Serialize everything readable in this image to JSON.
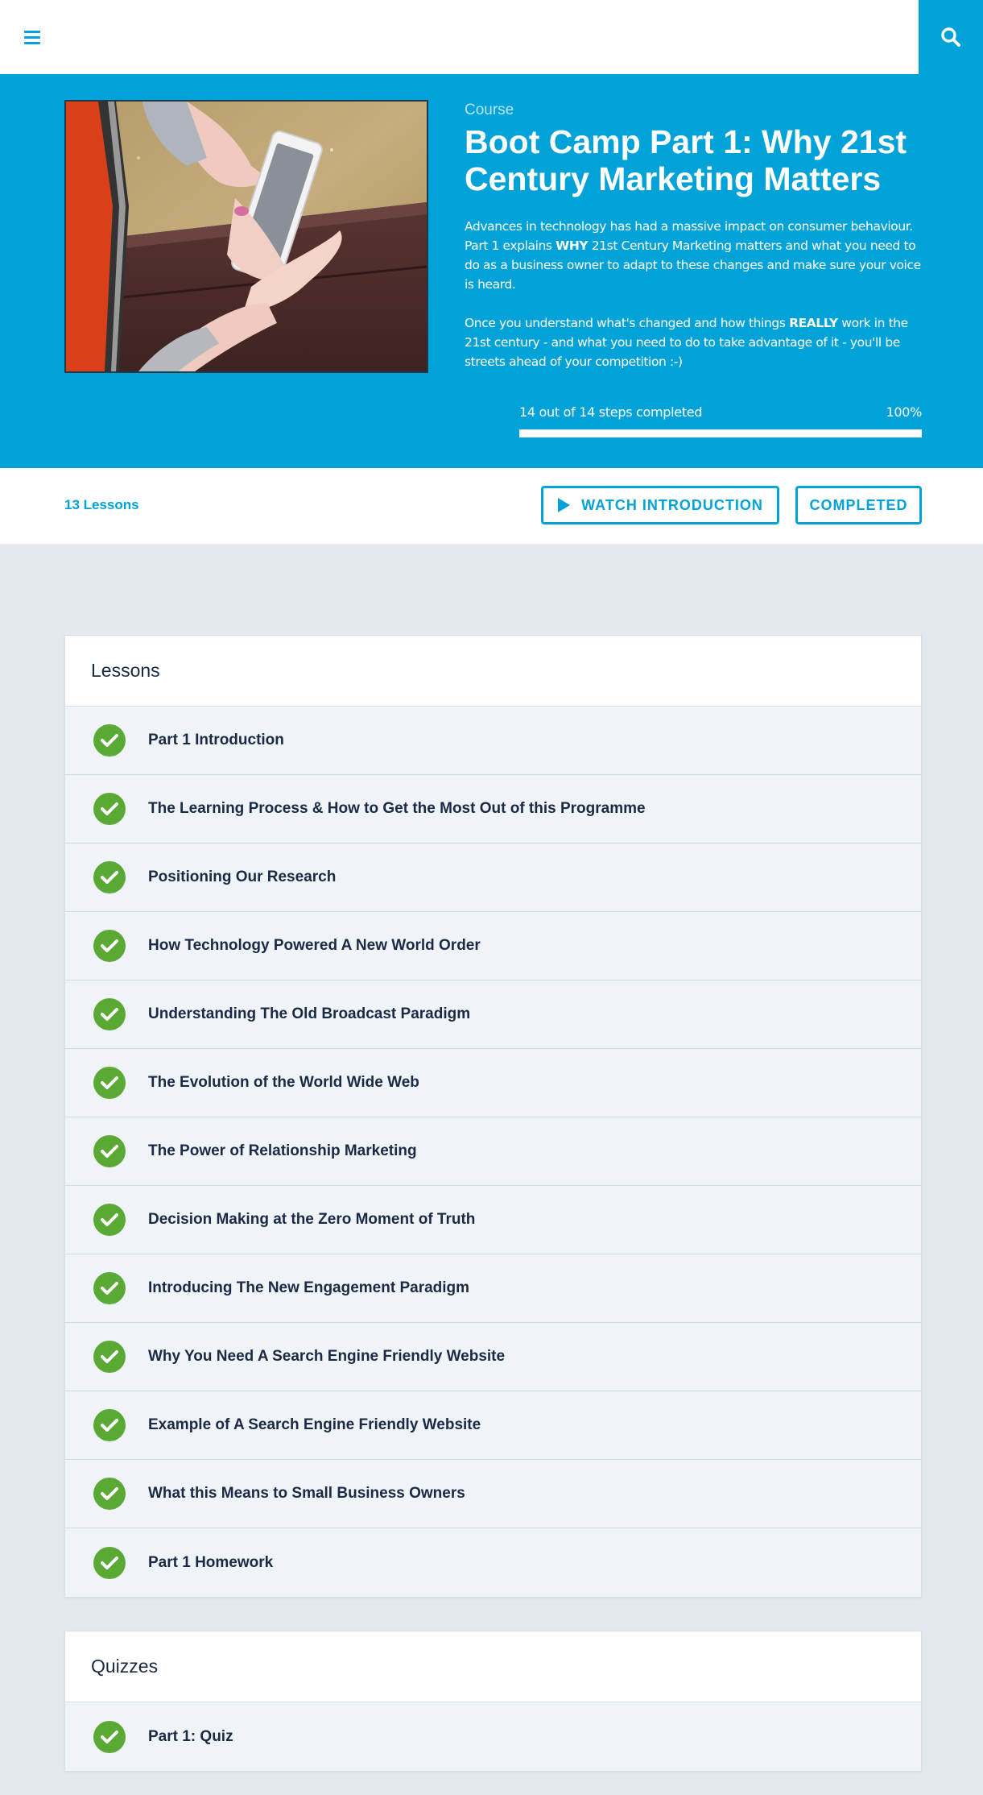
{
  "header": {
    "menu_icon": "hamburger-menu-icon",
    "search_icon": "search-icon"
  },
  "course": {
    "eyebrow": "Course",
    "title": "Boot Camp Part 1: Why 21st Century Marketing Matters",
    "desc1": {
      "a": "Advances in technology has had a massive impact on consumer behaviour. Part 1 explains ",
      "b": "WHY",
      "c": " 21st Century Marketing matters and what you need to do as a business owner to adapt to these changes and make sure your voice is heard."
    },
    "desc2": {
      "a": "Once you understand what's changed and how things ",
      "b": "REALLY",
      "c": " work in the 21st century - and what you need to do to take advantage of it - you'll be streets ahead of your competition :-)"
    },
    "progress_text": "14 out of 14 steps completed",
    "progress_percent_label": "100%",
    "progress_fraction": 1.0
  },
  "actions": {
    "lesson_count": "13 Lessons",
    "watch_label": "WATCH INTRODUCTION",
    "completed_label": "COMPLETED"
  },
  "lessons": {
    "heading": "Lessons",
    "items": [
      "Part 1 Introduction",
      "The Learning Process & How to Get the Most Out of this Programme",
      "Positioning Our Research",
      "How Technology Powered A New World Order",
      "Understanding The Old Broadcast Paradigm",
      "The Evolution of the World Wide Web",
      "The Power of Relationship Marketing",
      "Decision Making at the Zero Moment of Truth",
      "Introducing The New Engagement Paradigm",
      "Why You Need A Search Engine Friendly Website",
      "Example of A Search Engine Friendly Website",
      "What this Means to Small Business Owners",
      "Part 1 Homework"
    ]
  },
  "quizzes": {
    "heading": "Quizzes",
    "items": [
      "Part 1: Quiz"
    ]
  },
  "colors": {
    "accent": "#00a2d8",
    "check": "#5aa935"
  }
}
